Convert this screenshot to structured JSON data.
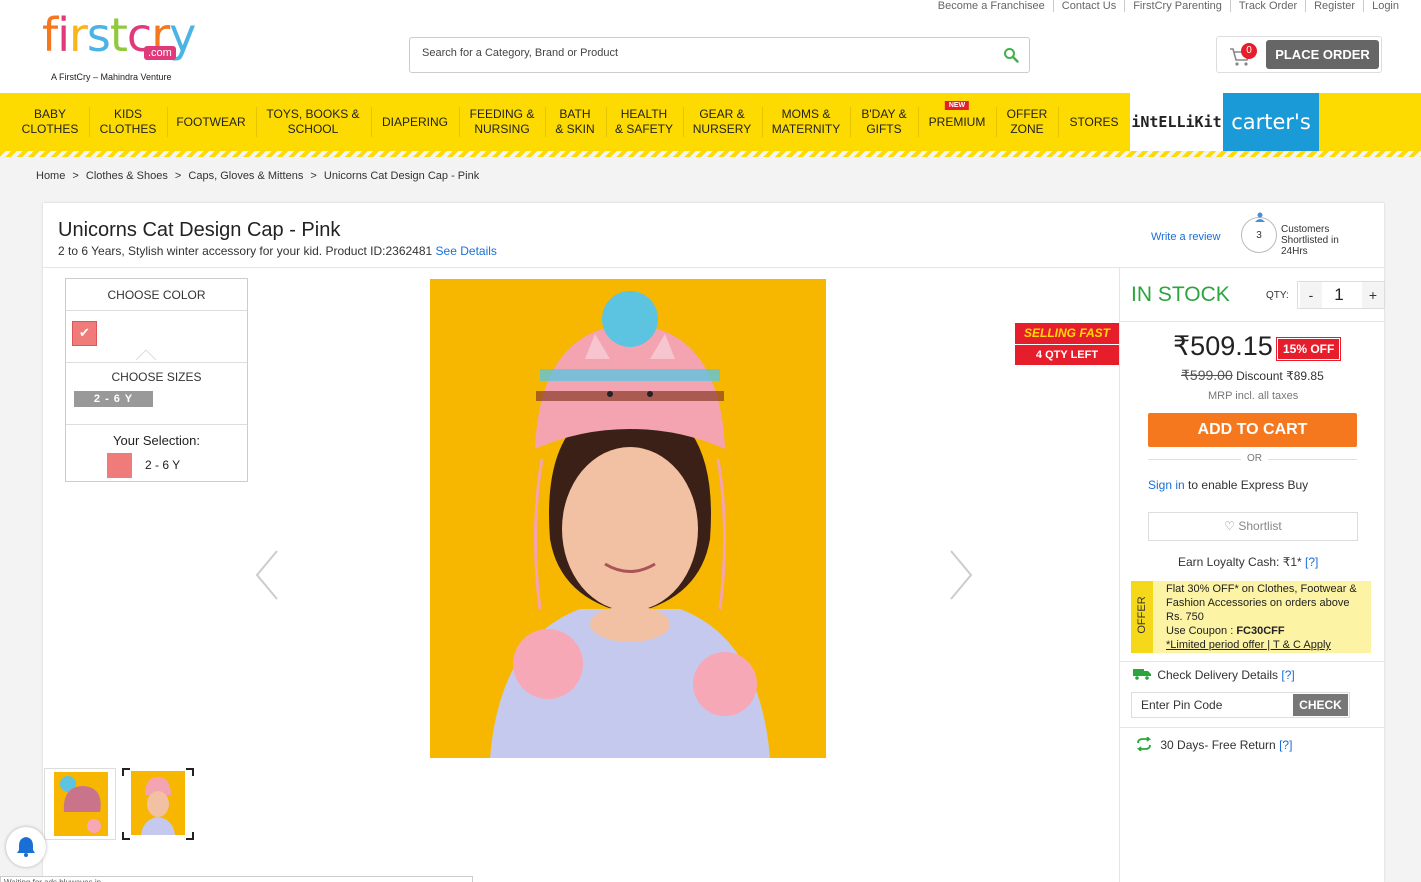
{
  "brand": {
    "logo_text": "firstcry",
    "logo_suffix": ".com",
    "tagline": "A FirstCry – Mahindra Venture"
  },
  "top_links": [
    "Become a Franchisee",
    "Contact Us",
    "FirstCry Parenting",
    "Track Order",
    "Register",
    "Login"
  ],
  "search": {
    "placeholder": "Search for a Category, Brand or Product"
  },
  "cart": {
    "count": "0",
    "place_order": "PLACE ORDER"
  },
  "nav": {
    "items": [
      {
        "line1": "BABY",
        "line2": "CLOTHES"
      },
      {
        "line1": "KIDS",
        "line2": "CLOTHES"
      },
      {
        "line1": "FOOTWEAR",
        "line2": ""
      },
      {
        "line1": "TOYS, BOOKS &",
        "line2": "SCHOOL"
      },
      {
        "line1": "DIAPERING",
        "line2": ""
      },
      {
        "line1": "FEEDING &",
        "line2": "NURSING"
      },
      {
        "line1": "BATH",
        "line2": "& SKIN"
      },
      {
        "line1": "HEALTH",
        "line2": "& SAFETY"
      },
      {
        "line1": "GEAR &",
        "line2": "NURSERY"
      },
      {
        "line1": "MOMS &",
        "line2": "MATERNITY"
      },
      {
        "line1": "B'DAY &",
        "line2": "GIFTS"
      },
      {
        "line1": "PREMIUM",
        "line2": ""
      },
      {
        "line1": "OFFER",
        "line2": "ZONE"
      },
      {
        "line1": "STORES",
        "line2": ""
      }
    ],
    "new_badge": "NEW",
    "intellikit": "iNtELLiKit",
    "carters": "carter's"
  },
  "breadcrumb": [
    "Home",
    ">",
    "Clothes & Shoes",
    ">",
    "Caps, Gloves & Mittens",
    ">",
    "Unicorns Cat Design Cap - Pink"
  ],
  "product": {
    "title": "Unicorns Cat Design Cap - Pink",
    "subtitle": "2 to 6 Years, Stylish winter accessory for your kid. Product ID:2362481",
    "see_details": "See Details",
    "write_review": "Write a review",
    "shortlisted_count": "3",
    "shortlisted_text": "Customers Shortlisted in 24Hrs"
  },
  "options": {
    "color_head": "CHOOSE COLOR",
    "size_head": "CHOOSE SIZES",
    "size_value": "2 - 6 Y",
    "selection_head": "Your Selection:",
    "selection_size": "2 - 6 Y",
    "color_hex": "#f07b7b"
  },
  "badges": {
    "selling_fast": "SELLING FAST",
    "qty_left": "4 QTY LEFT"
  },
  "buy": {
    "stock": "IN STOCK",
    "qty_label": "QTY:",
    "qty_minus": "-",
    "qty_value": "1",
    "qty_plus": "+",
    "price": "₹509.15",
    "off": "15% OFF",
    "mrp": "₹599.00",
    "discount_label": "Discount",
    "discount_value": "₹89.85",
    "mrp_note": "MRP incl. all taxes",
    "add_to_cart": "ADD TO CART",
    "or": "OR",
    "sign_in": "Sign in",
    "sign_in_rest": "to enable Express Buy",
    "shortlist": "Shortlist",
    "loyalty": "Earn Loyalty Cash: ₹1*",
    "loyalty_help": "[?]"
  },
  "offer": {
    "tab": "OFFER",
    "line1": "Flat 30% OFF* on Clothes, Footwear & Fashion Accessories on orders above Rs. 750",
    "coupon_label": "Use Coupon :",
    "coupon_code": "FC30CFF",
    "terms": "*Limited period offer | T & C Apply"
  },
  "delivery": {
    "label": "Check Delivery Details",
    "help": "[?]",
    "pin_placeholder": "Enter Pin Code",
    "check": "CHECK"
  },
  "returns": {
    "label": "30 Days- Free Return",
    "help": "[?]"
  },
  "status_strip": "Waiting for ads.bluwaves.in...",
  "colors": {
    "brand_yellow": "#fddb00",
    "cta_orange": "#f5781f",
    "stock_green": "#2aa63d",
    "sale_red": "#e61e2b",
    "link_blue": "#1a6fd6"
  }
}
